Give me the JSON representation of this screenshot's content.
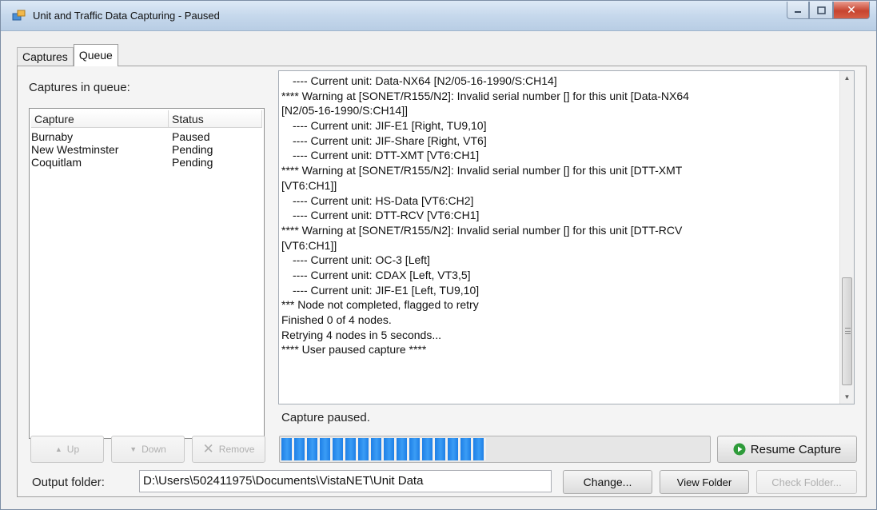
{
  "window": {
    "title": "Unit and Traffic Data Capturing - Paused"
  },
  "tabs": [
    {
      "label": "Captures"
    },
    {
      "label": "Queue"
    }
  ],
  "queue": {
    "heading": "Captures in queue:",
    "columns": [
      "Capture",
      "Status"
    ],
    "rows": [
      {
        "capture": "Burnaby",
        "status": "Paused"
      },
      {
        "capture": "New Westminster",
        "status": "Pending"
      },
      {
        "capture": "Coquitlam",
        "status": "Pending"
      }
    ],
    "up_label": "Up",
    "down_label": "Down",
    "remove_label": "Remove"
  },
  "log": {
    "lines": [
      "---- Current unit: Data-NX64 [N2/05-16-1990/S:CH14]",
      "**** Warning at [SONET/R155/N2]: Invalid serial number [] for this unit [Data-NX64",
      "[N2/05-16-1990/S:CH14]]",
      "---- Current unit: JIF-E1 [Right, TU9,10]",
      "---- Current unit: JIF-Share [Right, VT6]",
      "---- Current unit: DTT-XMT [VT6:CH1]",
      "**** Warning at [SONET/R155/N2]: Invalid serial number [] for this unit [DTT-XMT",
      "[VT6:CH1]]",
      "---- Current unit: HS-Data [VT6:CH2]",
      "---- Current unit: DTT-RCV [VT6:CH1]",
      "**** Warning at [SONET/R155/N2]: Invalid serial number [] for this unit [DTT-RCV",
      "[VT6:CH1]]",
      "---- Current unit: OC-3 [Left]",
      "---- Current unit: CDAX [Left, VT3,5]",
      "---- Current unit: JIF-E1 [Left, TU9,10]",
      "*** Node not completed, flagged to retry",
      "Finished 0 of 4 nodes.",
      "Retrying 4 nodes in 5 seconds...",
      "**** User paused capture ****"
    ]
  },
  "status": {
    "text": "Capture paused.",
    "progress": 0.49
  },
  "resume_label": "Resume Capture",
  "output": {
    "label": "Output folder:",
    "path": "D:\\Users\\502411975\\Documents\\VistaNET\\Unit Data",
    "change_label": "Change...",
    "view_label": "View Folder",
    "check_label": "Check Folder..."
  },
  "colors": {
    "progress": "#1e7fe6",
    "resume_icon": "#2e9b3a"
  }
}
